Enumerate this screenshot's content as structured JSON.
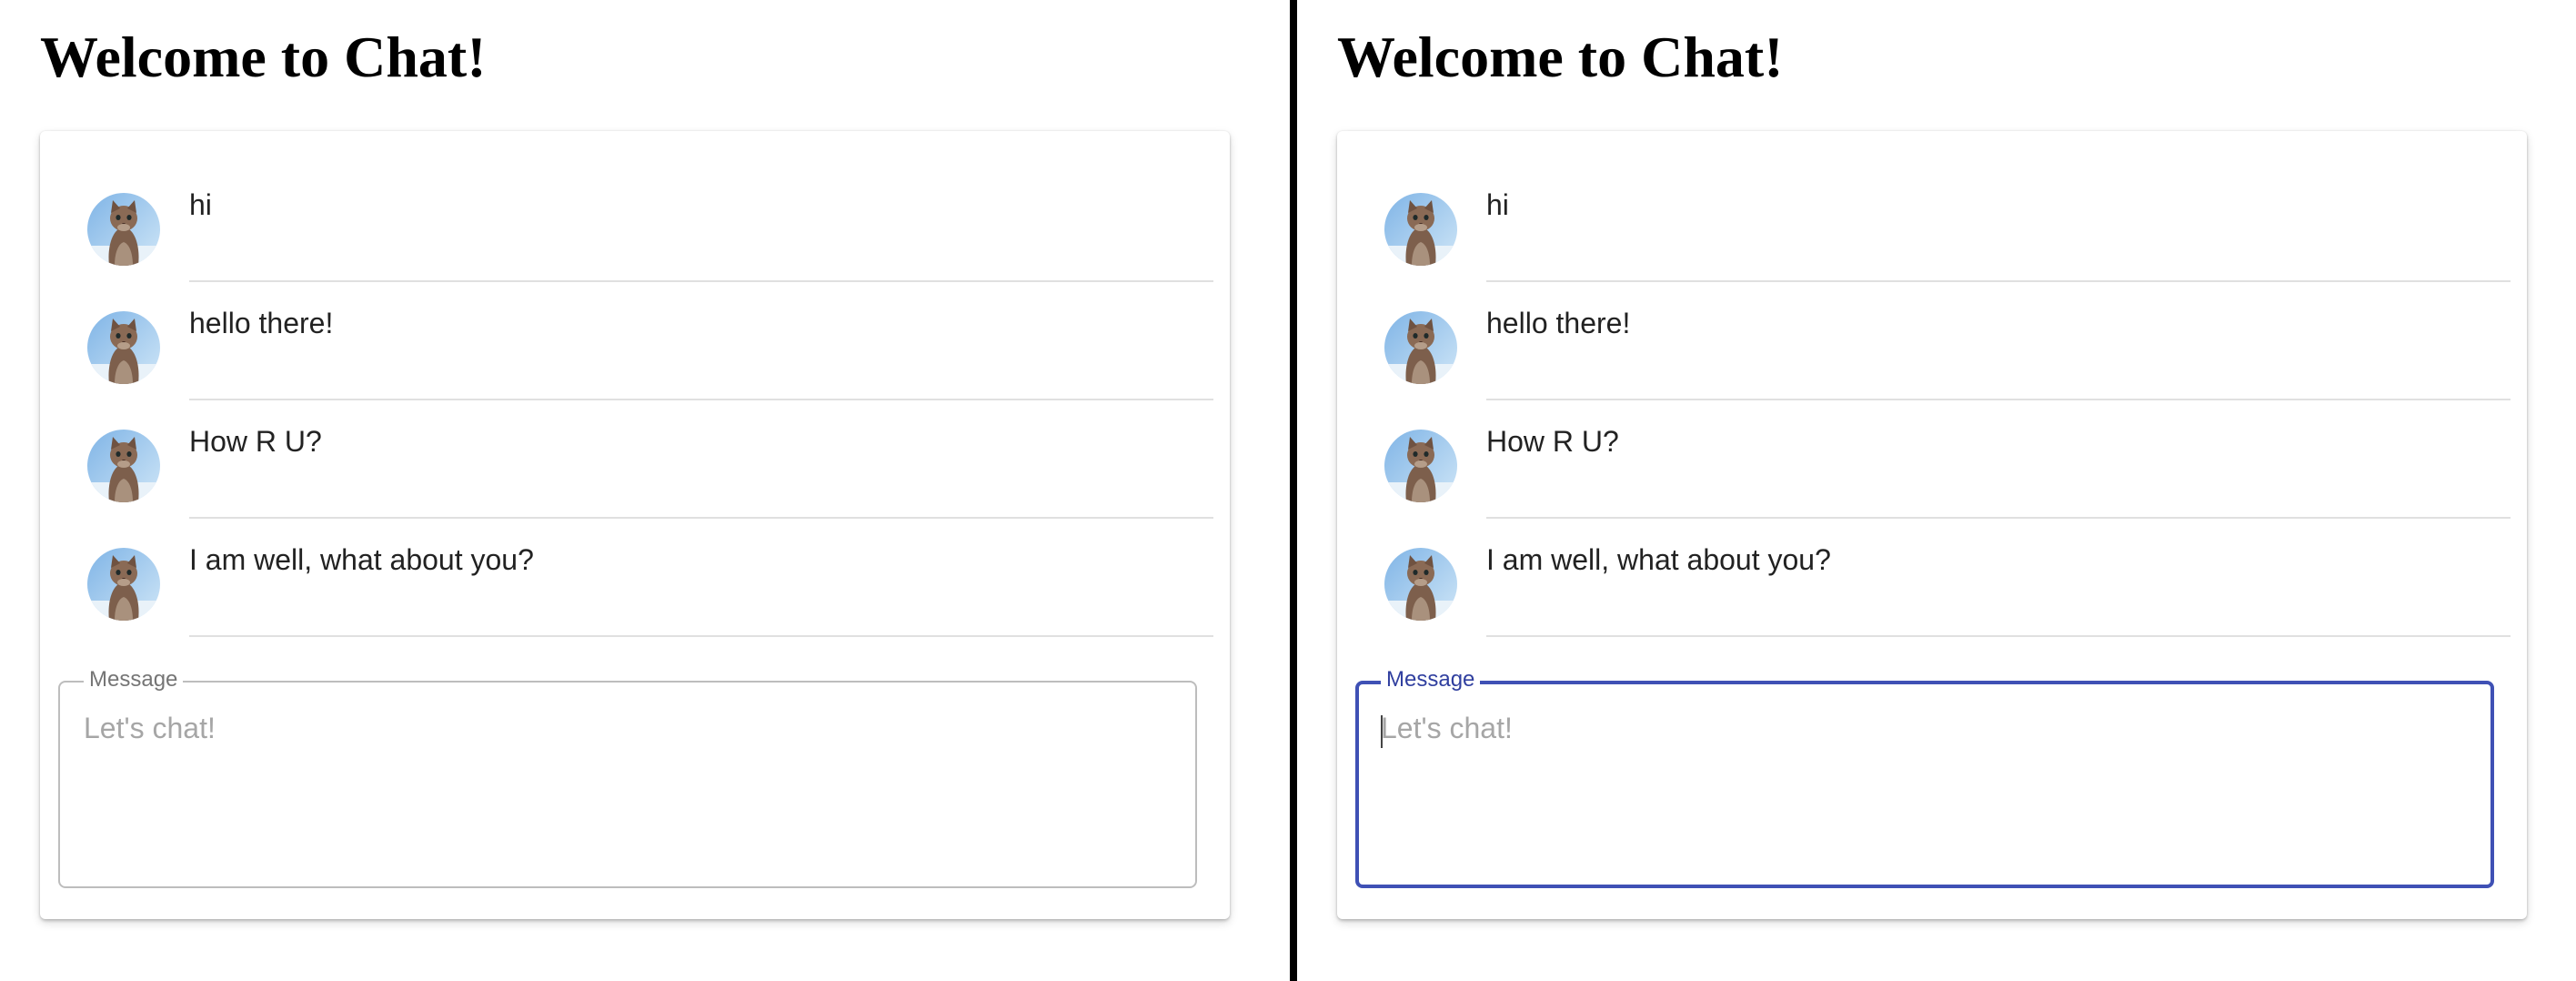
{
  "panels": [
    {
      "state": "unfocused",
      "title": "Welcome to Chat!",
      "messages": [
        {
          "text": "hi"
        },
        {
          "text": "hello there!"
        },
        {
          "text": "How R U?"
        },
        {
          "text": "I am well, what about you?"
        }
      ],
      "input": {
        "label": "Message",
        "placeholder": "Let's chat!",
        "value": "",
        "focused": false
      }
    },
    {
      "state": "focused",
      "title": "Welcome to Chat!",
      "messages": [
        {
          "text": "hi"
        },
        {
          "text": "hello there!"
        },
        {
          "text": "How R U?"
        },
        {
          "text": "I am well, what about you?"
        }
      ],
      "input": {
        "label": "Message",
        "placeholder": "Let's chat!",
        "value": "",
        "focused": true
      }
    }
  ],
  "avatar_icon": "cat-avatar-icon",
  "colors": {
    "focus_accent": "#3f51b5",
    "idle_border": "#bdbdbd",
    "divider": "#000000",
    "message_rule": "#e0e0e0",
    "placeholder": "#a6a6a6"
  }
}
